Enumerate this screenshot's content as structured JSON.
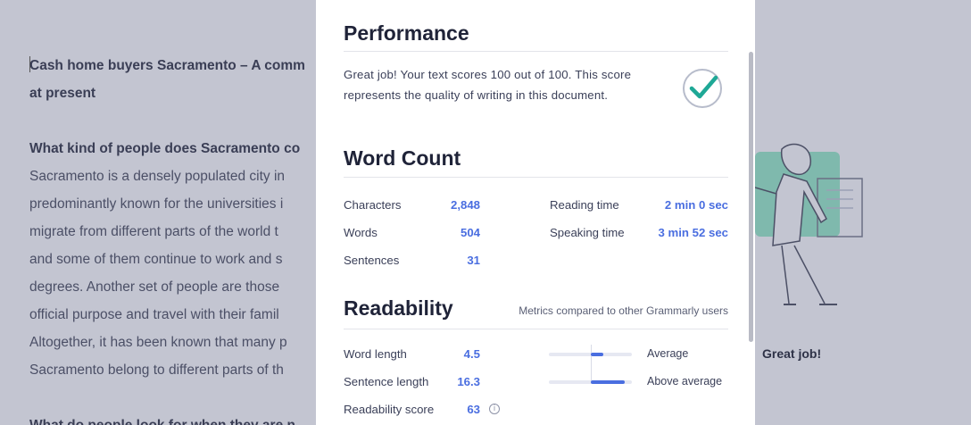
{
  "document": {
    "heading1_line1": "Cash home buyers Sacramento – A comm",
    "heading1_line2": "at present",
    "heading2": "What kind of people does Sacramento co",
    "paragraph_lines": [
      "Sacramento is a densely populated city in",
      "predominantly known for the universities i",
      "migrate from different parts of the world t",
      "and some of them continue to work and s",
      "degrees. Another set of people are those",
      "official purpose and travel with their famil",
      "Altogether, it has been known that many p",
      "Sacramento belong to different parts of th"
    ],
    "heading3": "What do people look for when they are n"
  },
  "side_panel": {
    "great_job": "Great job!"
  },
  "performance": {
    "title": "Performance",
    "text": "Great job! Your text scores 100 out of 100. This score represents the quality of writing in this document.",
    "score": 100,
    "icon": "check-circle-icon",
    "accent": "#1ea896"
  },
  "word_count": {
    "title": "Word Count",
    "left": [
      {
        "label": "Characters",
        "value": "2,848"
      },
      {
        "label": "Words",
        "value": "504"
      },
      {
        "label": "Sentences",
        "value": "31"
      }
    ],
    "right": [
      {
        "label": "Reading time",
        "value": "2 min 0 sec"
      },
      {
        "label": "Speaking time",
        "value": "3 min 52 sec"
      }
    ]
  },
  "readability": {
    "title": "Readability",
    "note": "Metrics compared to other Grammarly users",
    "rows": [
      {
        "label": "Word length",
        "value": "4.5",
        "comparison": "Average"
      },
      {
        "label": "Sentence length",
        "value": "16.3",
        "comparison": "Above average"
      },
      {
        "label": "Readability score",
        "value": "63",
        "icon": "info-icon"
      }
    ]
  },
  "colors": {
    "accent_blue": "#4a6ee0",
    "check_green": "#1ea896",
    "overlay": "#c3c5d1"
  }
}
